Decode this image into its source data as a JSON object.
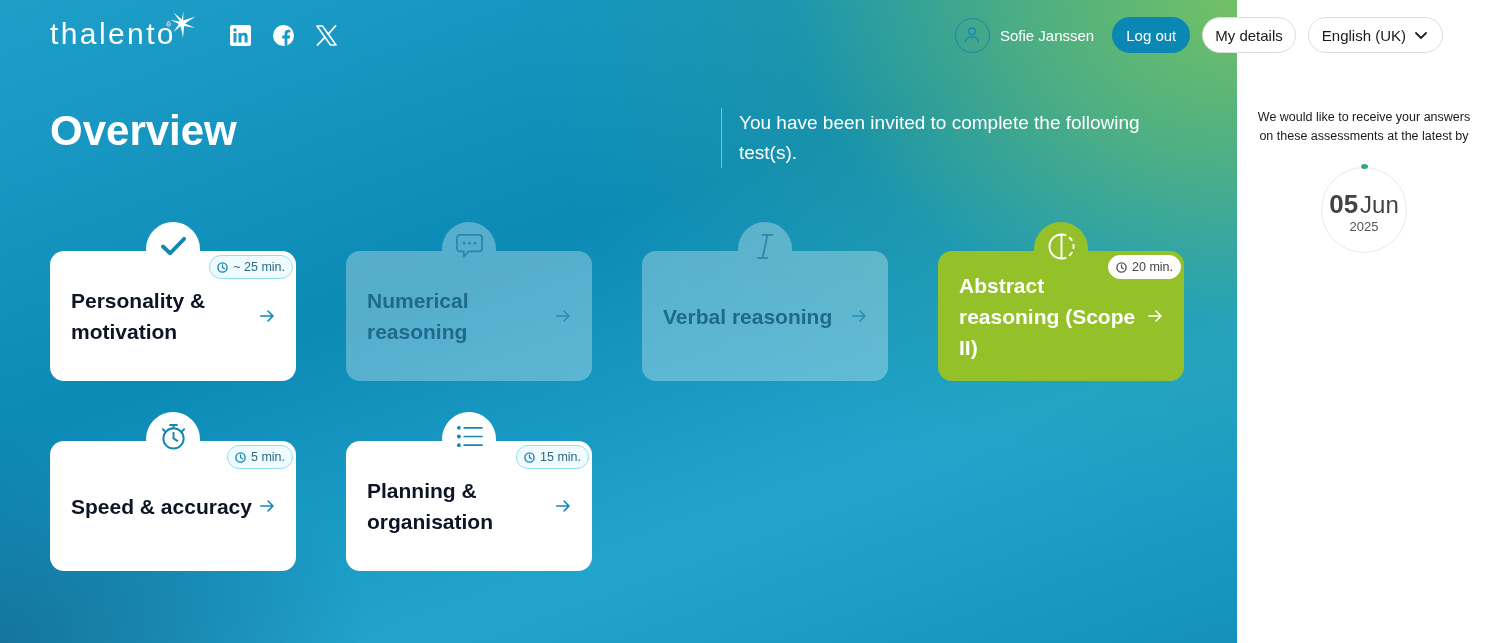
{
  "header": {
    "logo": {
      "name": "thalento$^{®}$"
    },
    "user": {
      "name": "Sofie Janssen"
    },
    "buttons": [
      {
        "label": "Log out",
        "kind": "primary"
      },
      {
        "label": "My details",
        "kind": "secondary"
      }
    ],
    "language": {
      "value": "English (UK)"
    }
  },
  "page": {
    "title": "Overview",
    "intro": "You have been invited to complete the following test(s)."
  },
  "tests": [
    {
      "title": "Personality & motivation",
      "duration": "~ 25 min.",
      "completed": true,
      "disabled": false,
      "highlighted": false
    },
    {
      "title": "Numerical reasoning",
      "completed": false,
      "disabled": true,
      "highlighted": false
    },
    {
      "title": "Verbal reasoning",
      "completed": false,
      "disabled": true,
      "highlighted": false
    },
    {
      "title": "Abstract reasoning (Scope II)",
      "duration": "20 min.",
      "completed": false,
      "disabled": false,
      "highlighted": true
    },
    {
      "title": "Speed & accuracy",
      "duration": "5 min.",
      "completed": false,
      "disabled": false,
      "highlighted": false
    },
    {
      "title": "Planning & organisation",
      "duration": "15 min.",
      "completed": false,
      "disabled": false,
      "highlighted": false
    }
  ],
  "deadline": {
    "note": "We would like to receive your answers on these assessments at the latest by",
    "day": "05",
    "month": "Jun",
    "year": "2025"
  }
}
